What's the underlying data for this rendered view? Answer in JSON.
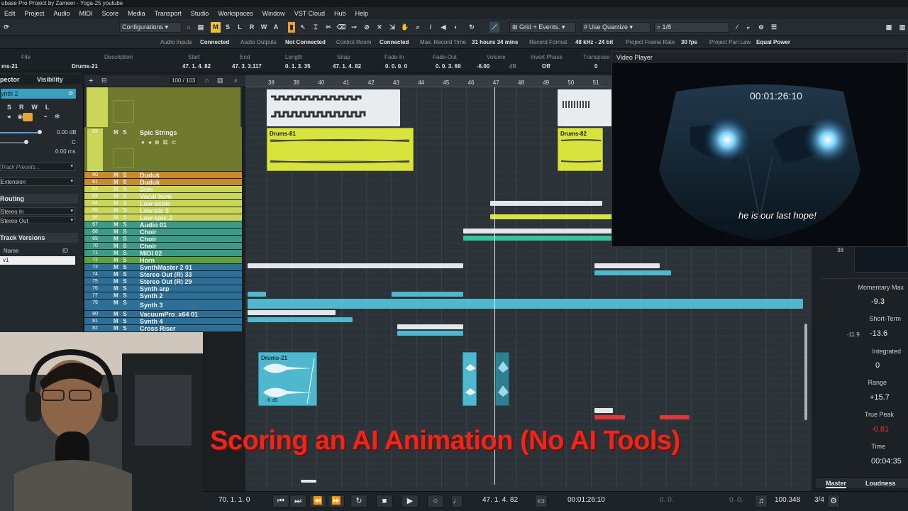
{
  "window": {
    "title": "ubase Pro Project by Zameer - Yoga-25 youtube"
  },
  "menu": [
    "Edit",
    "Project",
    "Audio",
    "MIDI",
    "Score",
    "Media",
    "Transport",
    "Studio",
    "Workspaces",
    "Window",
    "VST Cloud",
    "Hub",
    "Help"
  ],
  "toolbar": {
    "configurations": "Configurations",
    "modes": [
      "M",
      "S",
      "L",
      "R",
      "W",
      "A"
    ],
    "grid": "Grid + Events.",
    "quantize_mode": "Use Quantize",
    "quantize": "1/8"
  },
  "status": {
    "audio_inputs_label": "Audio Inputs",
    "audio_inputs": "Connected",
    "audio_outputs_label": "Audio Outputs",
    "audio_outputs": "Not Connected",
    "control_room_label": "Control Room",
    "control_room": "Connected",
    "max_record_label": "Max. Record Time",
    "max_record": "31 hours 34 mins",
    "record_format_label": "Record Format",
    "record_format": "48 kHz - 24 bit",
    "frame_rate_label": "Project Frame Rate",
    "frame_rate": "30 fps",
    "pan_law_label": "Project Pan Law",
    "pan_law": "Equal Power"
  },
  "infoline": {
    "labels": {
      "file": "File",
      "description": "Description",
      "start": "Start",
      "end": "End",
      "length": "Length",
      "snap": "Snap",
      "fadein": "Fade-In",
      "fadeout": "Fade-Out",
      "volume": "Volume",
      "invert": "Invert Phase",
      "transpose": "Transpose"
    },
    "values": {
      "file": "ms-21",
      "description": "Drums-21",
      "start": "47. 1. 4. 82",
      "end": "47. 3. 3.117",
      "length": "0. 1. 3. 35",
      "snap": "47. 1. 4. 82",
      "fadein": "0. 0. 0. 0",
      "fadeout": "0. 0. 3. 69",
      "volume": "-6.00",
      "volume_unit": "dB",
      "invert": "Off",
      "transpose": "0"
    }
  },
  "inspector": {
    "tab_inspector": "pector",
    "tab_visibility": "Visibility",
    "track": "ynth 2",
    "volume": "0.00 dB",
    "pan": "C",
    "delay": "0.00 ms",
    "track_presets": "Track Presets...",
    "extension": "Extension",
    "routing": "Routing",
    "in": "Stereo In",
    "out": "Stereo Out",
    "versions": "Track Versions",
    "col_name": "Name",
    "col_id": "ID",
    "version": "v1"
  },
  "tracklist": {
    "count": "100 / 103",
    "tracks": [
      {
        "num": "59",
        "name": "Spic Strings",
        "color": "#c9d65a"
      },
      {
        "num": "60",
        "name": "Duduk",
        "color": "#c78b2a"
      },
      {
        "num": "61",
        "name": "Duduk",
        "color": "#c78b2a"
      },
      {
        "num": "62",
        "name": "Spic",
        "color": "#c9d65a"
      },
      {
        "num": "63",
        "name": "Vocal hum",
        "color": "#c9d65a"
      },
      {
        "num": "64",
        "name": "Low aspic",
        "color": "#c9d65a"
      },
      {
        "num": "65",
        "name": "Low pic 3",
        "color": "#c9d65a"
      },
      {
        "num": "66",
        "name": "Low spic 2",
        "color": "#c9d65a"
      },
      {
        "num": "67",
        "name": "Audio 01",
        "color": "#3d9a86"
      },
      {
        "num": "68",
        "name": "Choir",
        "color": "#3d9a86"
      },
      {
        "num": "69",
        "name": "Choir",
        "color": "#3d9a86"
      },
      {
        "num": "70",
        "name": "Choir",
        "color": "#3d9a86"
      },
      {
        "num": "71",
        "name": "MIDI 02",
        "color": "#3d9a86"
      },
      {
        "num": "72",
        "name": "Horn",
        "color": "#5aa23c"
      },
      {
        "num": "73",
        "name": "SynthMaster 2 01",
        "color": "#2d6f97"
      },
      {
        "num": "74",
        "name": "Stereo Out (R) 33",
        "color": "#2d6f97"
      },
      {
        "num": "75",
        "name": "Stereo Out (R) 29",
        "color": "#2d6f97"
      },
      {
        "num": "76",
        "name": "Synth arp",
        "color": "#2d6f97"
      },
      {
        "num": "77",
        "name": "Synth 2",
        "color": "#2d6f97"
      },
      {
        "num": "79",
        "name": "Synth 3",
        "color": "#2d6f97"
      },
      {
        "num": "80",
        "name": "VacuumPro_x64 01",
        "color": "#2d6f97"
      },
      {
        "num": "81",
        "name": "Synth 4",
        "color": "#2d6f97"
      },
      {
        "num": "82",
        "name": "Cross Riser",
        "color": "#2d6f97"
      }
    ]
  },
  "ruler": [
    "38",
    "39",
    "40",
    "41",
    "42",
    "43",
    "44",
    "45",
    "46",
    "47",
    "48",
    "49",
    "50",
    "51"
  ],
  "clips": {
    "drums81": "Drums-81",
    "drums82": "Drums-82",
    "drums21": "Drums-21",
    "drums21_gain": "-6 dB"
  },
  "video": {
    "title": "Video Player",
    "timecode": "00:01:26:10",
    "subtitle": "he is our last hope!"
  },
  "meter": {
    "scale": "38",
    "momentary_label": "Momentary Max",
    "momentary": "-9.3",
    "short_label": "Short-Term",
    "short": "-13.6",
    "short_min": "-11.9",
    "integrated_label": "Integrated",
    "integrated": "0",
    "range_label": "Range",
    "range": "+15.7",
    "truepeak_label": "True Peak",
    "truepeak": "-0.81",
    "time_label": "Time",
    "time": "00:04:35",
    "tab_master": "Master",
    "tab_loudness": "Loudness"
  },
  "transport": {
    "left_locator": "70. 1. 1. 0",
    "position": "47. 1. 4. 82",
    "timecode": "00:01:26:10",
    "tempo": "100.348",
    "signature": "3/4",
    "zero1": "0. 0.",
    "zero2": "0. 0."
  },
  "overlay": {
    "text": "Scoring an AI Animation (No AI Tools)"
  },
  "colors": {
    "accent_orange": "#e8a23a",
    "yellow_clip": "#d9e33e",
    "teal_clip": "#4fb8cf",
    "overlay_red": "#e8281e"
  }
}
